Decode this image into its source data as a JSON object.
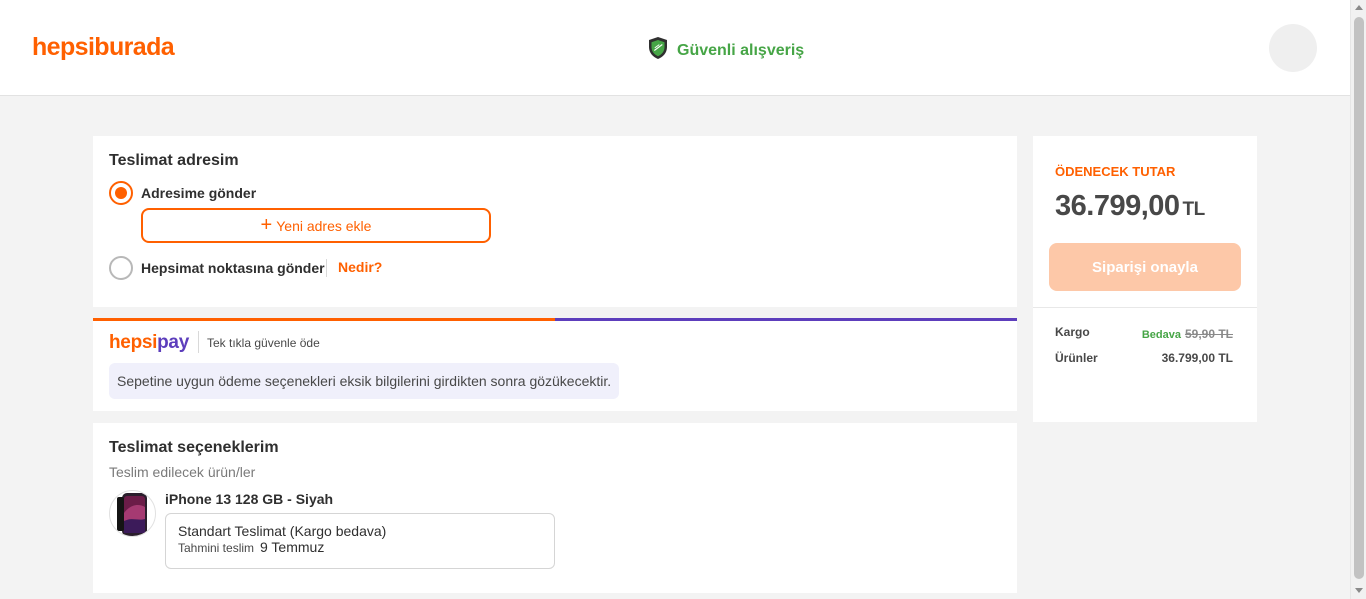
{
  "header": {
    "logo": "hepsiburada",
    "secure_label": "Güvenli alışveriş"
  },
  "address": {
    "title": "Teslimat adresim",
    "option_home": "Adresime gönder",
    "new_address_plus": "+",
    "new_address_label": "Yeni adres ekle",
    "option_point": "Hepsimat noktasına gönder",
    "what_is_link": "Nedir?"
  },
  "payment": {
    "logo_first": "hepsi",
    "logo_second": "pay",
    "tagline": "Tek tıkla güvenle öde",
    "note": "Sepetine uygun ödeme seçenekleri eksik bilgilerini girdikten sonra gözükecektir."
  },
  "shipping": {
    "title": "Teslimat seçeneklerim",
    "subtitle": "Teslim edilecek ürün/ler",
    "product_name": "iPhone 13 128 GB - Siyah",
    "method": "Standart Teslimat (Kargo bedava)",
    "estimate_label": "Tahmini teslim",
    "estimate_date": "9 Temmuz"
  },
  "summary": {
    "title": "ÖDENECEK TUTAR",
    "amount": "36.799,00",
    "currency": "TL",
    "confirm_button": "Siparişi onayla",
    "cargo_label": "Kargo",
    "cargo_free": "Bedava",
    "cargo_old_price": "59,90 TL",
    "products_label": "Ürünler",
    "products_price": "36.799,00 TL"
  },
  "colors": {
    "brand_orange": "#ff6000",
    "hepsipay_purple": "#5d3ebc",
    "secure_green": "#46a546",
    "confirm_disabled": "#fdc8a8"
  }
}
